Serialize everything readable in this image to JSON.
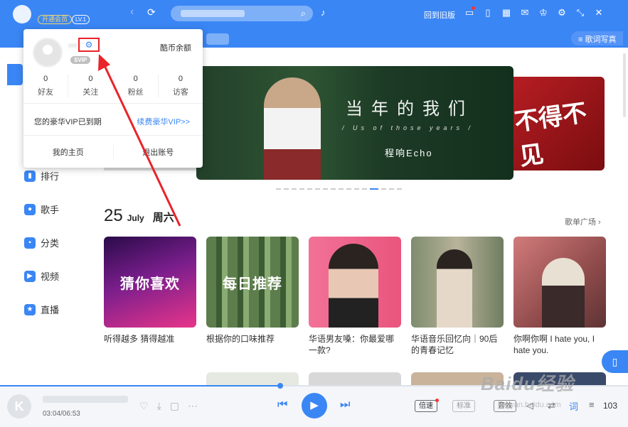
{
  "titlebar": {
    "vip_button": "开通会员",
    "level_badge": "LV.1",
    "old_version": "回到旧版",
    "icons": [
      "tv-icon",
      "phone-icon",
      "grid-icon",
      "mail-icon",
      "skin-icon",
      "gear-icon",
      "minimize-icon",
      "close-icon"
    ]
  },
  "tabbar": {
    "lyric_label": "歌词写真"
  },
  "sidebar": {
    "items": [
      {
        "label": "排行",
        "icon": "chart-icon"
      },
      {
        "label": "歌手",
        "icon": "singer-icon"
      },
      {
        "label": "分类",
        "icon": "category-icon"
      },
      {
        "label": "视频",
        "icon": "video-icon"
      },
      {
        "label": "直播",
        "icon": "live-icon"
      }
    ]
  },
  "user_panel": {
    "coins_label": "酷币余额",
    "svip_badge": "SVIP",
    "stats": [
      {
        "value": "0",
        "label": "好友"
      },
      {
        "value": "0",
        "label": "关注"
      },
      {
        "value": "0",
        "label": "粉丝"
      },
      {
        "value": "0",
        "label": "访客"
      }
    ],
    "vip_expired": "您的豪华VIP已到期",
    "renew_link": "续费豪华VIP>>",
    "my_home": "我的主页",
    "logout": "退出账号"
  },
  "banner": {
    "title_cn": "当年的我们",
    "title_en": "/ Us of those years /",
    "artist": "程响Echo",
    "right_text": "不得不见"
  },
  "daily": {
    "day": "25",
    "month": "July",
    "weekday": "周六",
    "playlist_link": "歌单广场 ›"
  },
  "cards": [
    {
      "cover_text": "猜你喜欢",
      "title": "听得越多 猜得越准",
      "colors": [
        "#4a1b6b",
        "#d92c8a"
      ]
    },
    {
      "cover_text": "每日推荐",
      "title": "根据你的口味推荐",
      "colors": [
        "#6d8e5c",
        "#2f4a2a"
      ]
    },
    {
      "cover_text": "",
      "title": "华语男友嗓：你最爱哪一款?",
      "colors": [
        "#f06a8e",
        "#e8557a"
      ]
    },
    {
      "cover_text": "",
      "title": "华语音乐回忆向｜90后的青春记忆",
      "colors": [
        "#8ea27a",
        "#5b6b4f"
      ]
    },
    {
      "cover_text": "",
      "title": "你啊你啊 I hate you, I hate you.",
      "colors": [
        "#c96a6a",
        "#8a4444"
      ]
    }
  ],
  "player": {
    "time": "03:04/06:53",
    "speed_label": "倍速",
    "quality_label": "标准",
    "eq_label": "音效",
    "playlist_count": "103",
    "progress": 0.446
  },
  "watermark": {
    "text": "Baidu经验",
    "url": "jingyan.baidu.com"
  }
}
